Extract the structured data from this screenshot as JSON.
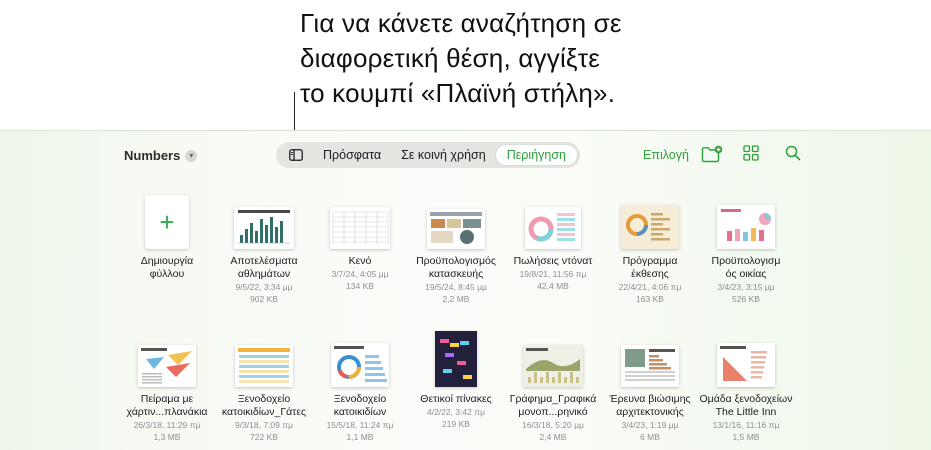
{
  "callout": {
    "lines": [
      "Για να κάνετε αναζήτηση σε",
      "διαφορετική θέση, αγγίξτε",
      "το κουμπί «Πλαϊνή στήλη»."
    ]
  },
  "toolbar": {
    "app_name": "Numbers",
    "tabs": [
      "Πρόσφατα",
      "Σε κοινή χρήση",
      "Περιήγηση"
    ],
    "active_tab": "Περιήγηση",
    "select_label": "Επιλογή",
    "icons": [
      "sidebar-icon",
      "new-folder-icon",
      "grid-view-icon",
      "search-icon"
    ]
  },
  "accent_color": "#2e9f3a",
  "documents": [
    {
      "name1": "Δημιουργία",
      "name2": "φύλλου",
      "date": "",
      "size": "",
      "kind": "new"
    },
    {
      "name1": "Αποτελέσματα",
      "name2": "αθλημάτων",
      "date": "9/5/22, 3:34 μμ",
      "size": "902 KB",
      "kind": "bars"
    },
    {
      "name1": "Κενό",
      "name2": "",
      "date": "3/7/24, 4:05 μμ",
      "size": "134 KB",
      "kind": "blank"
    },
    {
      "name1": "Προϋπολογισμός",
      "name2": "κατασκευής",
      "date": "19/5/24, 8:45 μμ",
      "size": "2,2 MB",
      "kind": "budget"
    },
    {
      "name1": "Πωλήσεις ντόνατ",
      "name2": "",
      "date": "19/8/21, 11:56 πμ",
      "size": "42,4 MB",
      "kind": "donut"
    },
    {
      "name1": "Πρόγραμμα",
      "name2": "έκθεσης",
      "date": "22/4/21, 4:06 πμ",
      "size": "163 KB",
      "kind": "schedule"
    },
    {
      "name1": "Προϋπολογισμ",
      "name2": "ός οικίας",
      "date": "3/4/23, 3:15 μμ",
      "size": "526 KB",
      "kind": "home"
    },
    {
      "name1": "Πείραμα με",
      "name2": "χάρτιν...πλανάκια",
      "date": "26/3/18, 11:29 πμ",
      "size": "1,3 MB",
      "kind": "planes"
    },
    {
      "name1": "Ξενοδοχείο",
      "name2": "κατοικιδίων_Γάτες",
      "date": "9/3/18, 7:09 πμ",
      "size": "722 KB",
      "kind": "cats"
    },
    {
      "name1": "Ξενοδοχείο",
      "name2": "κατοικιδίων",
      "date": "15/5/18, 11:24 πμ",
      "size": "1,1 MB",
      "kind": "pets"
    },
    {
      "name1": "Θετικοί πίνακες",
      "name2": "",
      "date": "4/2/22, 3:42 πμ",
      "size": "219 KB",
      "kind": "dark"
    },
    {
      "name1": "Γράφημα_Γραφικά",
      "name2": "μονοπ...ρηνικό",
      "date": "16/3/18, 5:20 μμ",
      "size": "2,4 MB",
      "kind": "trail"
    },
    {
      "name1": "Έρευνα βιώσιμης",
      "name2": "αρχιτεκτονικής",
      "date": "3/4/23, 1:19 μμ",
      "size": "6 MB",
      "kind": "arch"
    },
    {
      "name1": "Ομάδα ξενοδοχείων",
      "name2": "The Little Inn",
      "date": "13/1/16, 11:16 πμ",
      "size": "1,5 MB",
      "kind": "inn"
    }
  ]
}
